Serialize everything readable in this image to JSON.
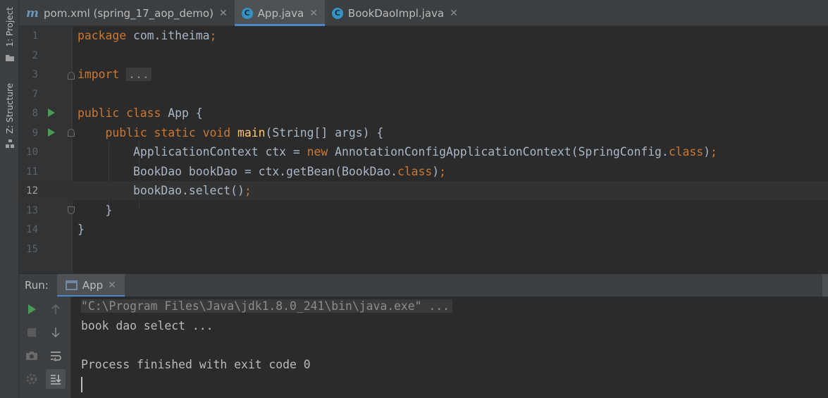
{
  "side_strip": {
    "project_label": "1: Project",
    "structure_label": "Z: Structure"
  },
  "tabs": [
    {
      "icon": "maven-m-icon",
      "label": "pom.xml (spring_17_aop_demo)",
      "active": false
    },
    {
      "icon": "java-class-run-icon",
      "label": "App.java",
      "active": true
    },
    {
      "icon": "java-class-icon",
      "label": "BookDaoImpl.java",
      "active": false
    }
  ],
  "editor": {
    "current_line": 12,
    "lines": [
      {
        "num": "1"
      },
      {
        "num": "2"
      },
      {
        "num": "3"
      },
      {
        "num": "7"
      },
      {
        "num": "8"
      },
      {
        "num": "9"
      },
      {
        "num": "10"
      },
      {
        "num": "11"
      },
      {
        "num": "12"
      },
      {
        "num": "13"
      },
      {
        "num": "14"
      },
      {
        "num": "15"
      }
    ],
    "code": {
      "l1_kw": "package",
      "l1_rest": " com.itheima",
      "l1_semi": ";",
      "l3_kw": "import",
      "l3_fold": "...",
      "l8_kw": "public class",
      "l8_rest": " App {",
      "l9_kw": "public static void",
      "l9_fn": " main",
      "l9_rest": "(String[] args) {",
      "l10_a": "ApplicationContext ctx = ",
      "l10_kw": "new",
      "l10_b": " AnnotationConfigApplicationContext(SpringConfig.",
      "l10_kw2": "class",
      "l10_c": ")",
      "l10_semi": ";",
      "l11_a": "BookDao bookDao = ctx.getBean(BookDao.",
      "l11_kw": "class",
      "l11_b": ")",
      "l11_semi": ";",
      "l12_a": "bookDao.select()",
      "l12_semi": ";",
      "l13": "}",
      "l14": "}"
    }
  },
  "run_panel": {
    "title": "Run:",
    "tab_label": "App",
    "console_lines": [
      "\"C:\\Program Files\\Java\\jdk1.8.0_241\\bin\\java.exe\" ...",
      "book dao select ...",
      "",
      "Process finished with exit code 0"
    ]
  },
  "colors": {
    "keyword": "#cc7832",
    "function": "#ffc66d",
    "plain": "#a9b7c6",
    "run_green": "#499c54",
    "accent_blue": "#4a88c7"
  }
}
